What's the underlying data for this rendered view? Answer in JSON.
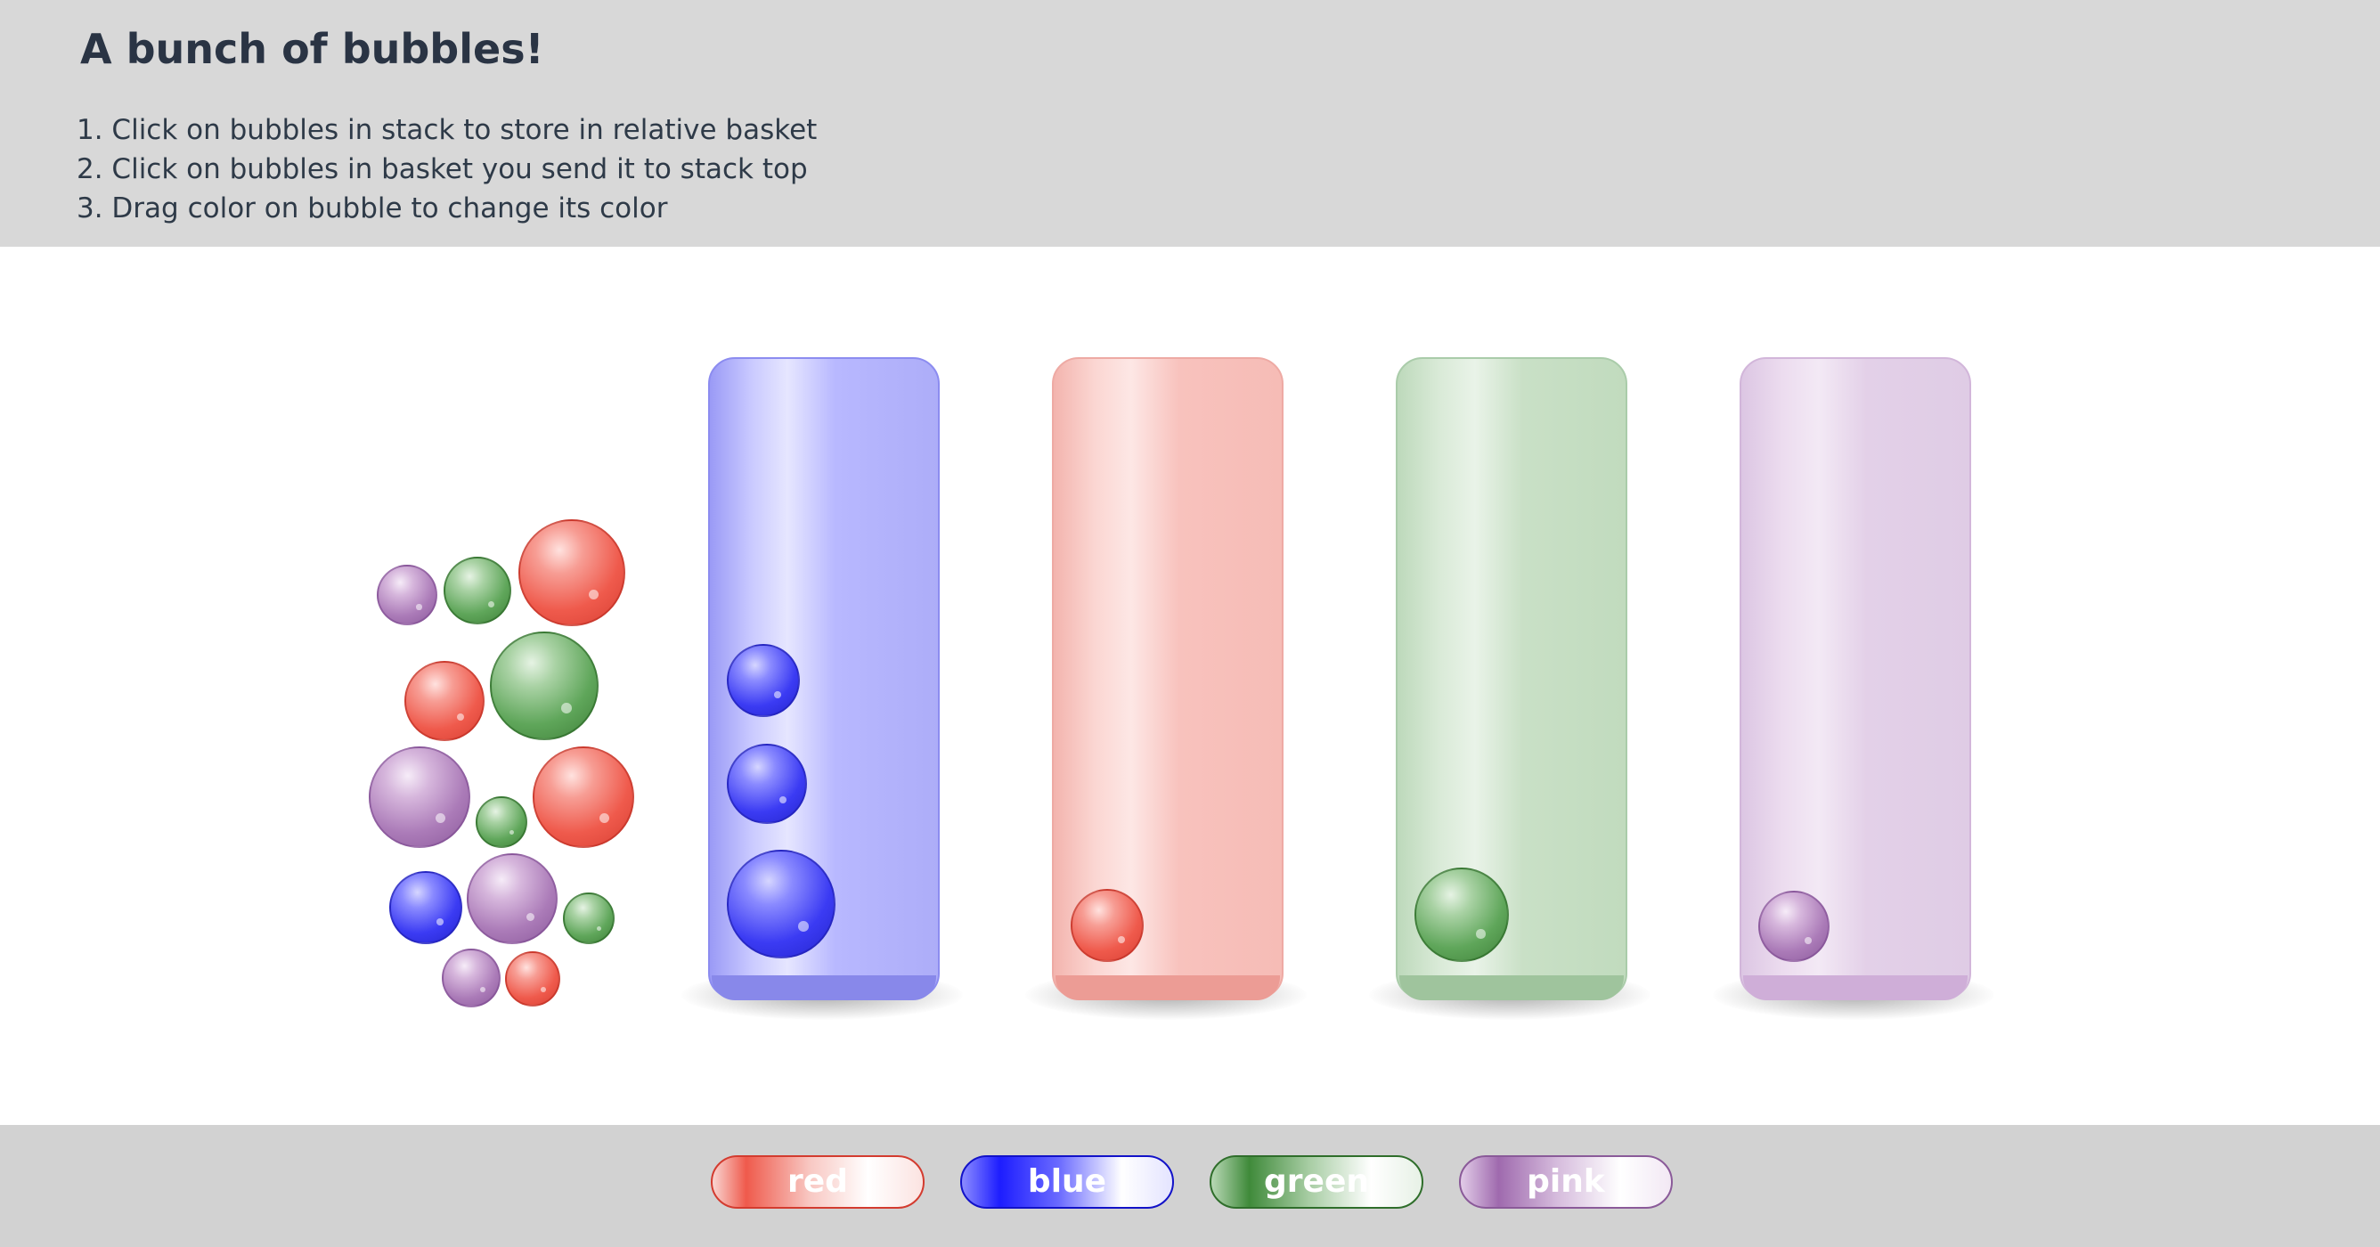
{
  "header": {
    "title": "A bunch of bubbles!",
    "instructions": [
      "1. Click on bubbles in stack to store in relative basket",
      "2. Click on bubbles in basket you send it to stack top",
      "3. Drag color on bubble to change its color"
    ]
  },
  "stack": {
    "bubbles": [
      "pink",
      "green",
      "red",
      "red",
      "green",
      "pink",
      "green",
      "red",
      "blue",
      "pink",
      "green",
      "pink",
      "red"
    ]
  },
  "baskets": [
    {
      "color": "blue",
      "bubbles": [
        "blue",
        "blue",
        "blue"
      ]
    },
    {
      "color": "red",
      "bubbles": [
        "red"
      ]
    },
    {
      "color": "green",
      "bubbles": [
        "green"
      ]
    },
    {
      "color": "pink",
      "bubbles": [
        "pink"
      ]
    }
  ],
  "palette": {
    "items": [
      {
        "label": "red",
        "color": "#ef5a4c"
      },
      {
        "label": "blue",
        "color": "#1d1dff"
      },
      {
        "label": "green",
        "color": "#3f8a3a"
      },
      {
        "label": "pink",
        "color": "#9f6aae"
      }
    ]
  },
  "colors": {
    "header_bg": "#d8d8d8",
    "footer_bg": "#d2d2d2",
    "title_text": "#2a3444"
  }
}
